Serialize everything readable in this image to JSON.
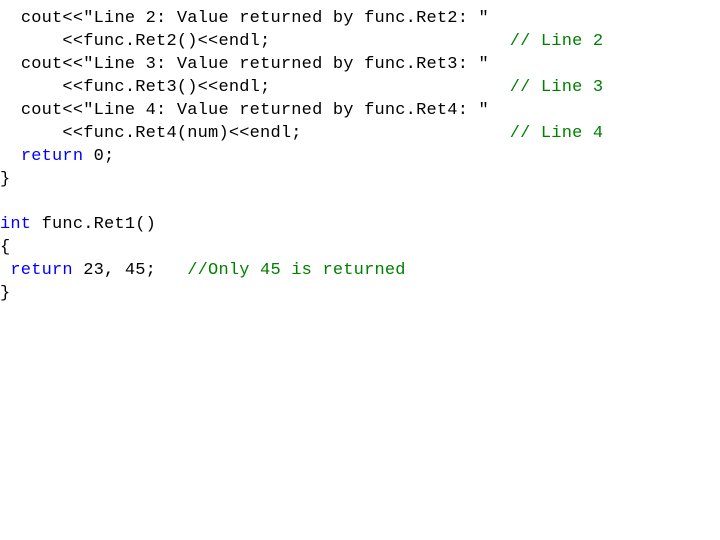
{
  "code": {
    "lines": [
      {
        "indent": "  ",
        "segments": [
          {
            "t": "cout<<",
            "c": "plain"
          },
          {
            "t": "\"Line 2: Value returned by func.Ret2: \"",
            "c": "str"
          }
        ]
      },
      {
        "indent": "      ",
        "segments": [
          {
            "t": "<<func.Ret2()<<endl;                       ",
            "c": "plain"
          },
          {
            "t": "// Line 2",
            "c": "cmt"
          }
        ]
      },
      {
        "indent": "  ",
        "segments": [
          {
            "t": "cout<<",
            "c": "plain"
          },
          {
            "t": "\"Line 3: Value returned by func.Ret3: \"",
            "c": "str"
          }
        ]
      },
      {
        "indent": "      ",
        "segments": [
          {
            "t": "<<func.Ret3()<<endl;                       ",
            "c": "plain"
          },
          {
            "t": "// Line 3",
            "c": "cmt"
          }
        ]
      },
      {
        "indent": "  ",
        "segments": [
          {
            "t": "cout<<",
            "c": "plain"
          },
          {
            "t": "\"Line 4: Value returned by func.Ret4: \"",
            "c": "str"
          }
        ]
      },
      {
        "indent": "      ",
        "segments": [
          {
            "t": "<<func.Ret4(num)<<endl;                    ",
            "c": "plain"
          },
          {
            "t": "// Line 4",
            "c": "cmt"
          }
        ]
      },
      {
        "indent": "  ",
        "segments": [
          {
            "t": "return",
            "c": "kw"
          },
          {
            "t": " 0;",
            "c": "plain"
          }
        ]
      },
      {
        "indent": "",
        "segments": [
          {
            "t": "}",
            "c": "plain"
          }
        ]
      },
      {
        "indent": "",
        "segments": [
          {
            "t": " ",
            "c": "plain"
          }
        ]
      },
      {
        "indent": "",
        "segments": [
          {
            "t": "int",
            "c": "kw"
          },
          {
            "t": " func.Ret1()",
            "c": "plain"
          }
        ]
      },
      {
        "indent": "",
        "segments": [
          {
            "t": "{",
            "c": "plain"
          }
        ]
      },
      {
        "indent": " ",
        "segments": [
          {
            "t": "return",
            "c": "kw"
          },
          {
            "t": " 23, 45;   ",
            "c": "plain"
          },
          {
            "t": "//Only 45 is returned",
            "c": "cmt"
          }
        ]
      },
      {
        "indent": "",
        "segments": [
          {
            "t": "}",
            "c": "plain"
          }
        ]
      }
    ]
  }
}
